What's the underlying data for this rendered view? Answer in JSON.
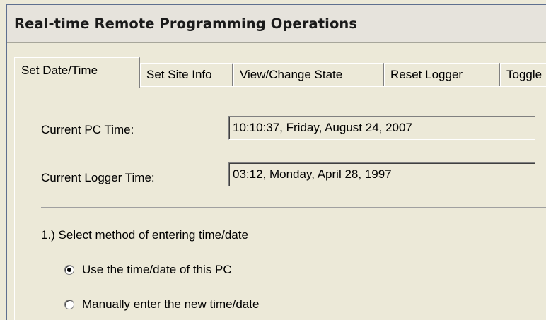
{
  "window": {
    "title": "Real-time Remote Programming Operations"
  },
  "tabs": [
    {
      "label": "Set Date/Time",
      "selected": true
    },
    {
      "label": "Set Site Info",
      "selected": false
    },
    {
      "label": "View/Change State",
      "selected": false
    },
    {
      "label": "Reset Logger",
      "selected": false
    },
    {
      "label": "Toggle",
      "selected": false
    }
  ],
  "fields": {
    "pc_time_label": "Current PC Time:",
    "pc_time_value": "10:10:37, Friday, August 24, 2007",
    "logger_time_label": "Current Logger Time:",
    "logger_time_value": "03:12, Monday, April 28, 1997"
  },
  "method": {
    "heading": "1.) Select method of entering time/date",
    "options": [
      {
        "label": "Use the time/date of this PC",
        "checked": true
      },
      {
        "label": "Manually enter the new time/date",
        "checked": false
      }
    ]
  }
}
